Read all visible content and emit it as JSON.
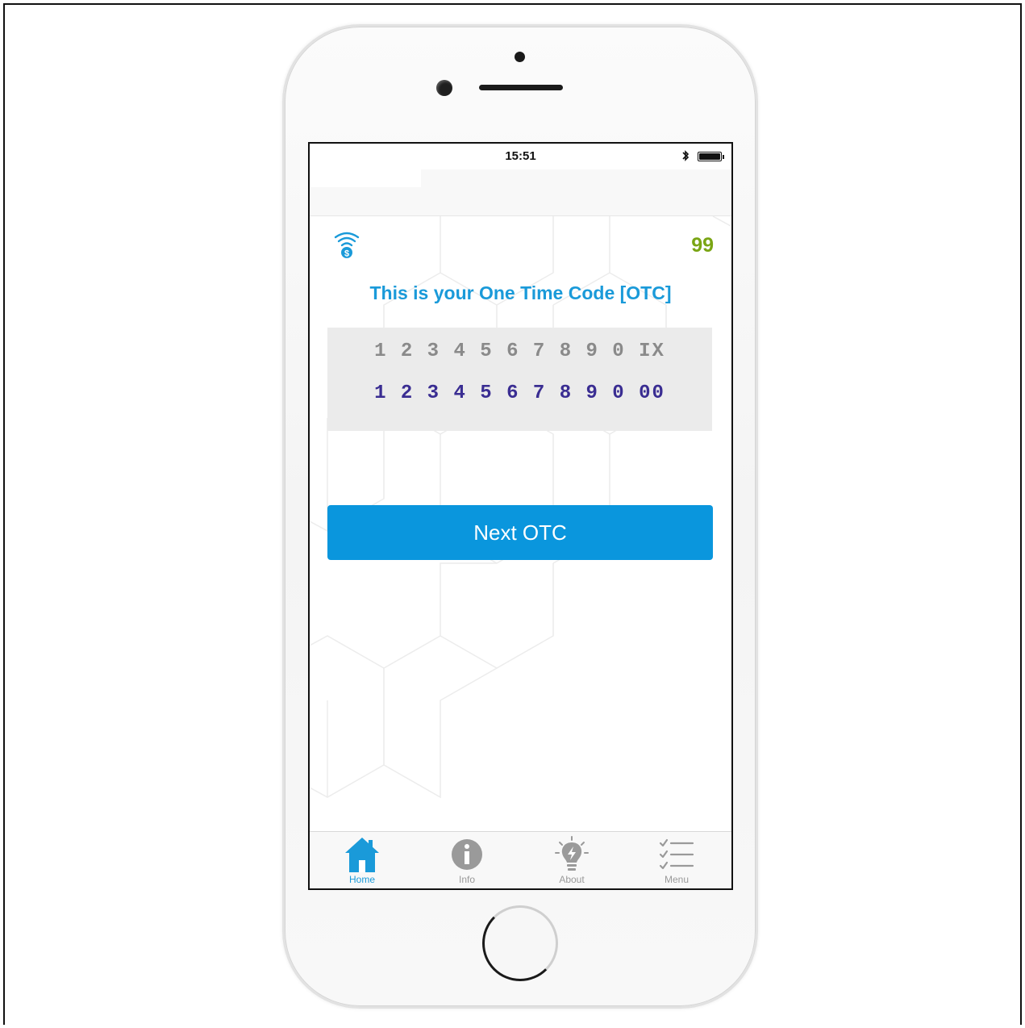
{
  "status_bar": {
    "time": "15:51"
  },
  "header": {
    "counter": "99"
  },
  "main": {
    "headline": "This is your One Time Code [OTC]",
    "code_rows": {
      "top": "1 2 3 4 5 6 7 8 9 0 IX",
      "bottom": "1 2 3 4 5 6 7 8 9 0 00"
    },
    "next_button_label": "Next OTC"
  },
  "tab_bar": {
    "items": [
      {
        "label": "Home",
        "icon": "home-icon",
        "active": true
      },
      {
        "label": "Info",
        "icon": "info-icon",
        "active": false
      },
      {
        "label": "About",
        "icon": "lightbulb-icon",
        "active": false
      },
      {
        "label": "Menu",
        "icon": "checklist-icon",
        "active": false
      }
    ]
  },
  "colors": {
    "accent": "#0a96dd",
    "headline": "#1a9ad9",
    "counter": "#7aa514",
    "code_bottom": "#3a2d92",
    "code_top": "#8a8a8a"
  }
}
